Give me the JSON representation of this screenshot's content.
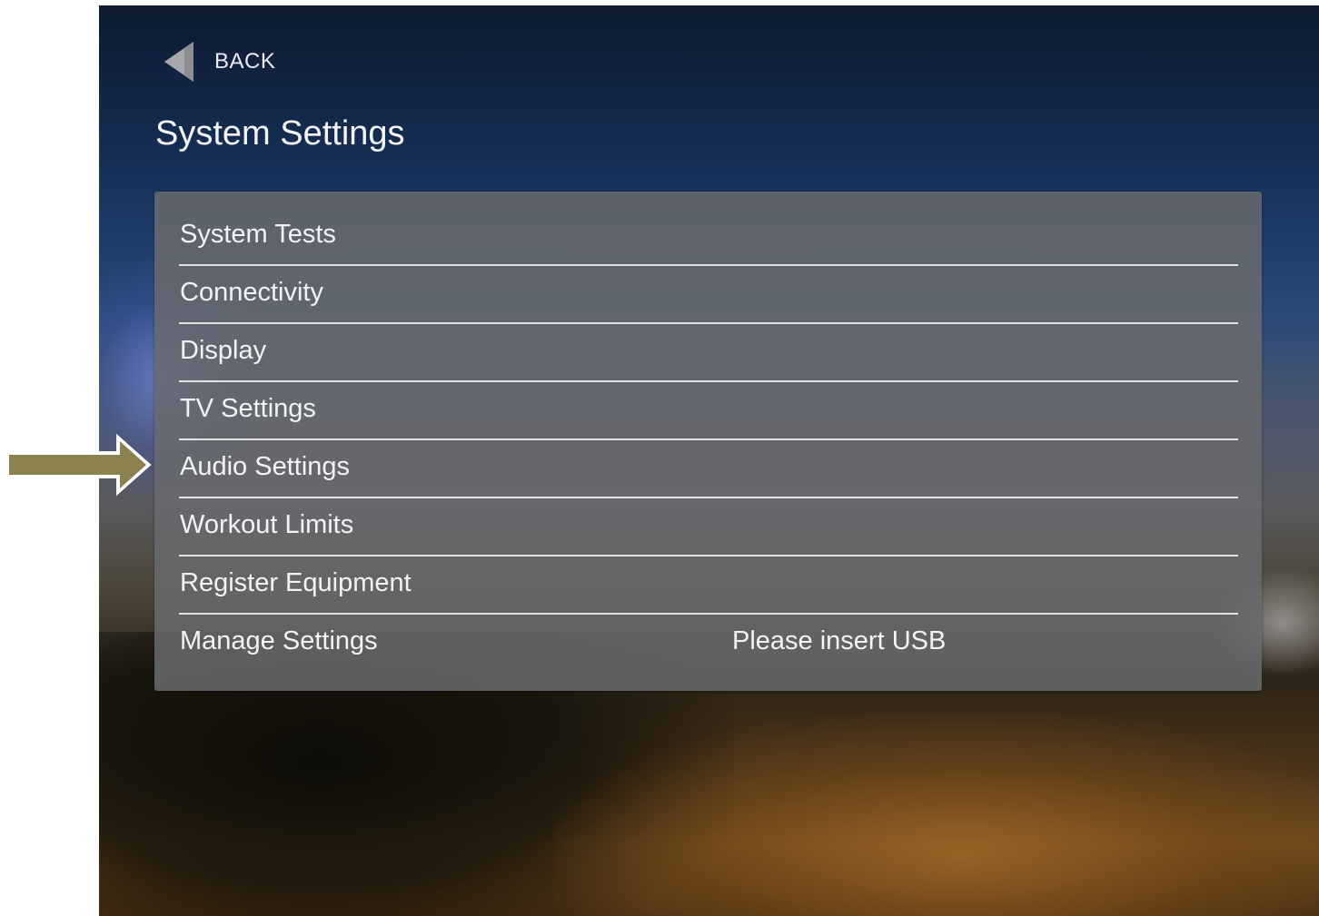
{
  "header": {
    "back_label": "BACK",
    "title": "System Settings"
  },
  "menu": {
    "items": [
      {
        "label": "System Tests",
        "status": ""
      },
      {
        "label": "Connectivity",
        "status": ""
      },
      {
        "label": "Display",
        "status": ""
      },
      {
        "label": "TV Settings",
        "status": ""
      },
      {
        "label": "Audio Settings",
        "status": ""
      },
      {
        "label": "Workout Limits",
        "status": ""
      },
      {
        "label": "Register Equipment",
        "status": ""
      },
      {
        "label": "Manage Settings",
        "status": "Please insert USB"
      }
    ]
  },
  "annotation": {
    "points_to": "Audio Settings",
    "arrow_color": "#8c8250"
  },
  "colors": {
    "panel": "#696a6e",
    "text": "#f2f3f5",
    "divider": "#eeeef0"
  },
  "icons": {
    "back": "left-triangle-icon",
    "pointer": "right-arrow-icon"
  }
}
